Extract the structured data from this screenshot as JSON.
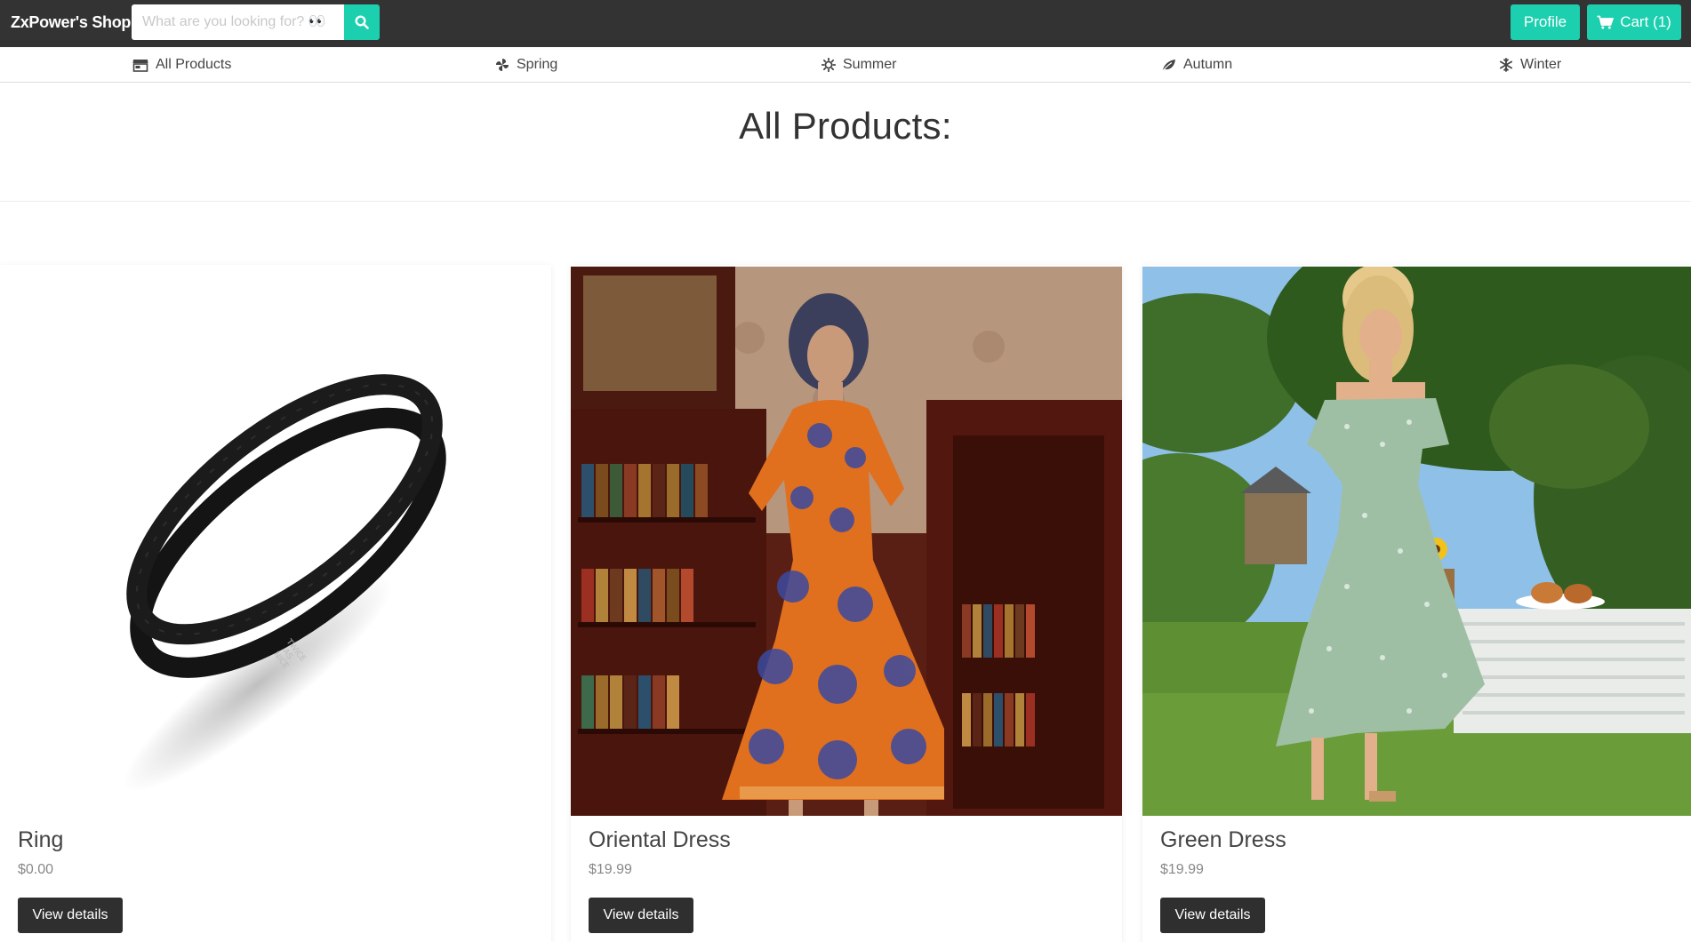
{
  "header": {
    "brand": "ZxPower's Shop",
    "search": {
      "placeholder": "What are you looking for? 👀",
      "value": ""
    },
    "profile_label": "Profile",
    "cart_label": "Cart (1)"
  },
  "seasons": [
    {
      "label": "All Products",
      "icon": "store-icon"
    },
    {
      "label": "Spring",
      "icon": "pinwheel-icon"
    },
    {
      "label": "Summer",
      "icon": "sun-icon"
    },
    {
      "label": "Autumn",
      "icon": "leaf-icon"
    },
    {
      "label": "Winter",
      "icon": "snowflake-icon"
    }
  ],
  "main": {
    "title": "All Products:"
  },
  "products": [
    {
      "name": "Ring",
      "price": "$0.00",
      "button": "View details",
      "image": "black double band ring"
    },
    {
      "name": "Oriental Dress",
      "price": "$19.99",
      "button": "View details",
      "image": "woman in orange patterned dress in library"
    },
    {
      "name": "Green Dress",
      "price": "$19.99",
      "button": "View details",
      "image": "woman in green floral dress in garden"
    }
  ],
  "colors": {
    "navbar": "#333333",
    "accent": "#1ccfae",
    "button_dark": "#2f2f2f"
  }
}
